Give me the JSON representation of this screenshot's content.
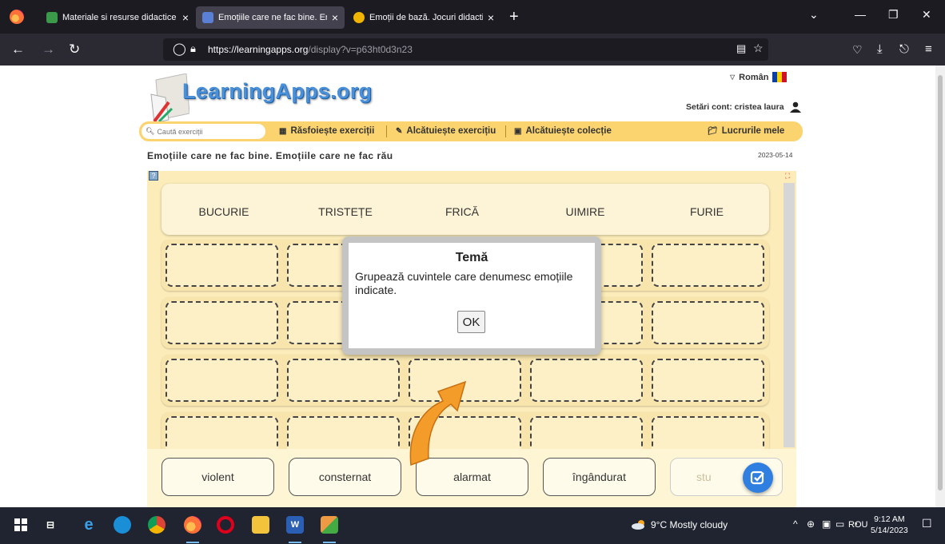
{
  "browser": {
    "tabs": [
      {
        "title": "Materiale si resurse didactice Ed",
        "close": "×",
        "favicon_color": "#3a9a4a"
      },
      {
        "title": "Emoțiile care ne fac bine. Emoț",
        "close": "×",
        "favicon_color": "#5a7fd6",
        "active": true
      },
      {
        "title": "Emoții de bază. Jocuri didactice",
        "close": "×",
        "favicon_color": "#f0b400"
      }
    ],
    "new_tab": "+",
    "url_host": "https://learningapps.org",
    "url_path": "/display?v=p63ht0d3n23"
  },
  "site": {
    "logo": "LearningApps.org",
    "language": "Român",
    "account": "Setări cont: cristea laura",
    "search_placeholder": "Caută exerciții",
    "menu": {
      "browse": "Răsfoiește exerciții",
      "create": "Alcătuiește exercițiu",
      "collection": "Alcătuiește colecție",
      "mine": "Lucrurile mele"
    },
    "exercise_title": "Emoțiile care ne fac bine. Emoțiile care ne fac rău",
    "exercise_date": "2023-05-14"
  },
  "app": {
    "categories": [
      "BUCURIE",
      "TRISTEȚE",
      "FRICĂ",
      "UIMIRE",
      "FURIE"
    ],
    "cards": [
      "violent",
      "consternat",
      "alarmat",
      "îngândurat",
      "stu"
    ],
    "dialog": {
      "title": "Temă",
      "text": "Grupează cuvintele care denumesc emoțiile indicate.",
      "ok": "OK"
    }
  },
  "taskbar": {
    "weather": "9°C  Mostly cloudy",
    "language": "ROU",
    "time": "9:12 AM",
    "date": "5/14/2023"
  },
  "colors": {
    "menu_bar": "#fbd46f",
    "app_bg": "#fcecb9",
    "check_button": "#2f7fe0",
    "arrow": "#f39c2a"
  }
}
